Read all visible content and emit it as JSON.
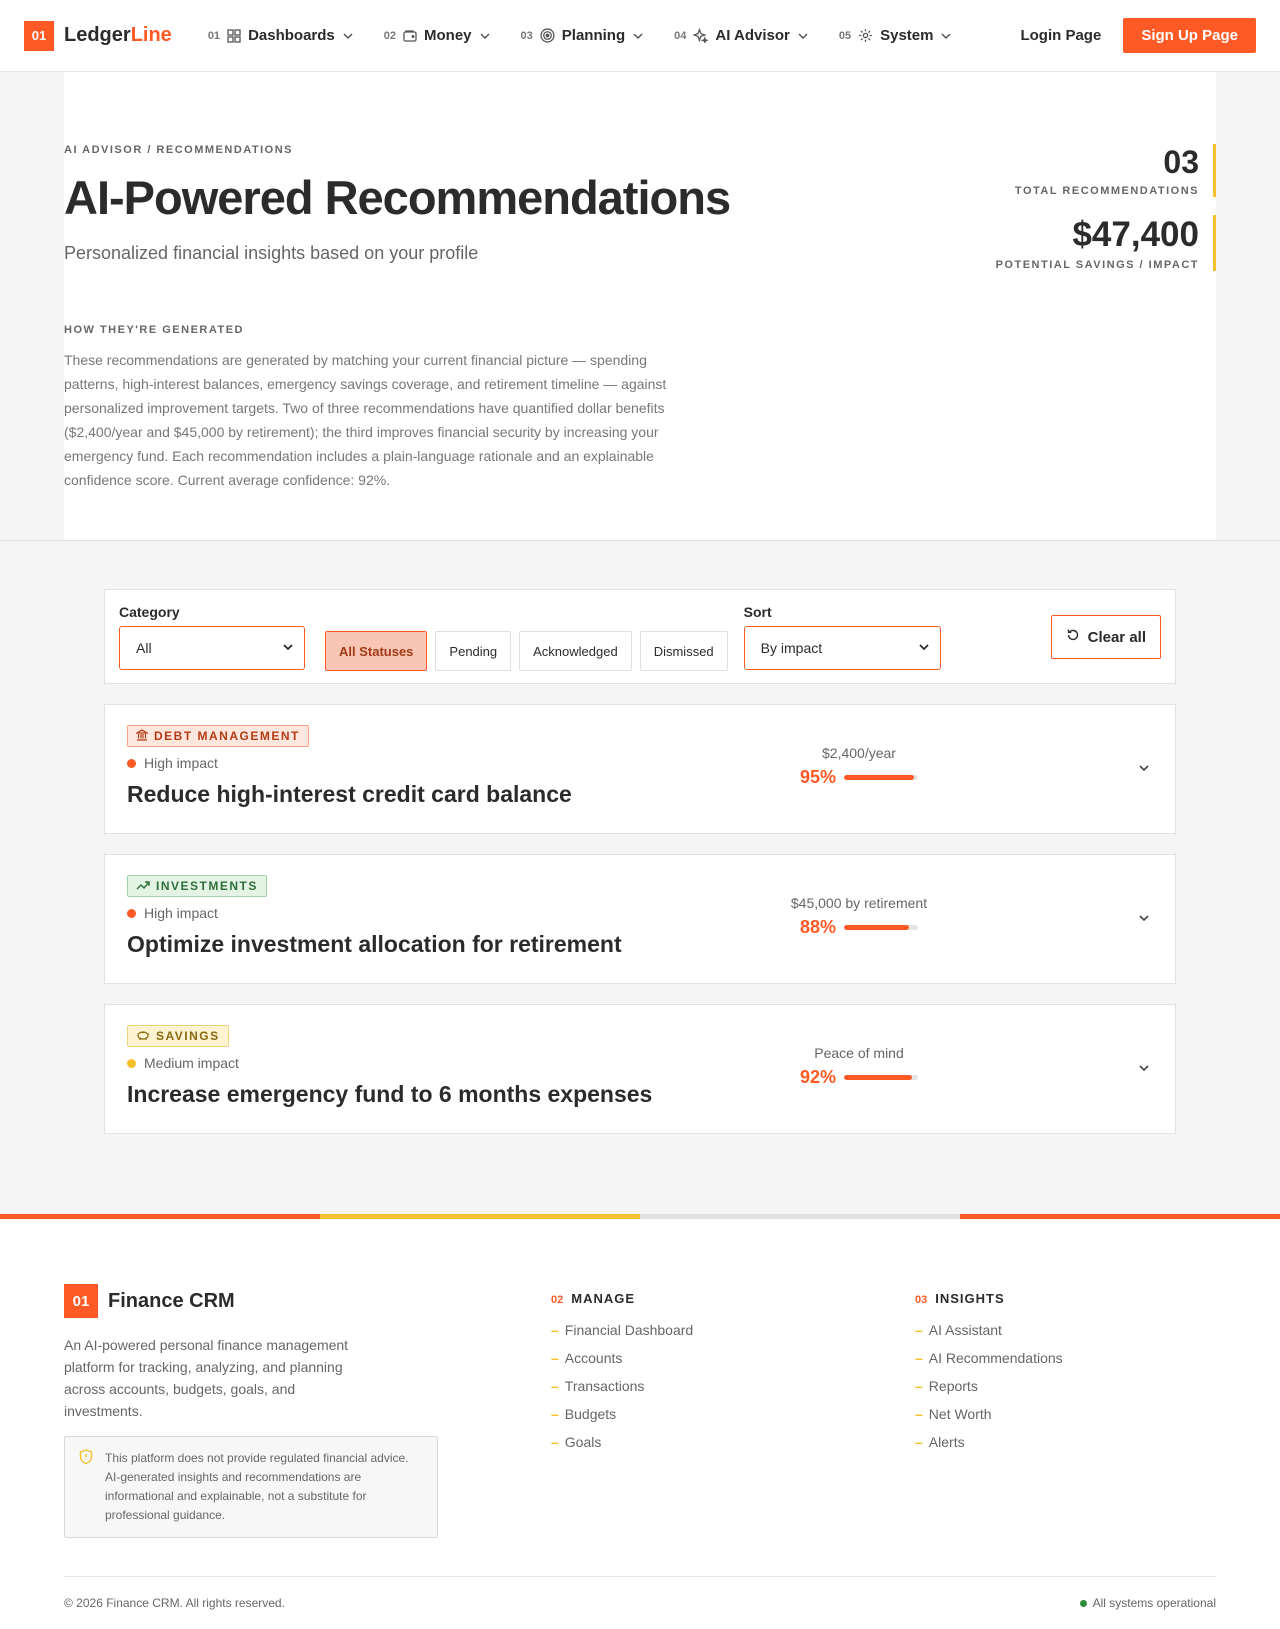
{
  "header": {
    "logo_badge": "01",
    "logo_text": "Ledger",
    "logo_accent": "Line",
    "nav": [
      {
        "num": "01",
        "label": "Dashboards",
        "icon": "grid-icon"
      },
      {
        "num": "02",
        "label": "Money",
        "icon": "wallet-icon"
      },
      {
        "num": "03",
        "label": "Planning",
        "icon": "target-icon"
      },
      {
        "num": "04",
        "label": "AI Advisor",
        "icon": "sparkle-icon"
      },
      {
        "num": "05",
        "label": "System",
        "icon": "gear-icon"
      }
    ],
    "login": "Login Page",
    "signup": "Sign Up Page"
  },
  "hero": {
    "eyebrow": "AI ADVISOR / RECOMMENDATIONS",
    "title": "AI-Powered Recommendations",
    "subtitle": "Personalized financial insights based on your profile",
    "how_title": "HOW THEY'RE GENERATED",
    "how_text": "These recommendations are generated by matching your current financial picture — spending patterns, high-interest balances, emergency savings coverage, and retirement timeline — against personalized improvement targets. Two of three recommendations have quantified dollar benefits ($2,400/year and $45,000 by retirement); the third improves financial security by increasing your emergency fund. Each recommendation includes a plain-language rationale and an explainable confidence score. Current average confidence: 92%.",
    "stats": [
      {
        "value": "03",
        "label": "TOTAL RECOMMENDATIONS"
      },
      {
        "value": "$47,400",
        "label": "POTENTIAL SAVINGS / IMPACT"
      }
    ]
  },
  "filters": {
    "category_label": "Category",
    "category_value": "All",
    "statuses": [
      "All Statuses",
      "Pending",
      "Acknowledged",
      "Dismissed"
    ],
    "active_status": "All Statuses",
    "sort_label": "Sort",
    "sort_value": "By impact",
    "clear": "Clear all"
  },
  "recommendations": [
    {
      "tag": "DEBT MANAGEMENT",
      "tag_icon": "bank-icon",
      "impact": "High impact",
      "title": "Reduce high-interest credit card balance",
      "benefit": "$2,400/year",
      "confidence": "95%",
      "confidence_value": 0.95
    },
    {
      "tag": "INVESTMENTS",
      "tag_icon": "trend-up-icon",
      "impact": "High impact",
      "title": "Optimize investment allocation for retirement",
      "benefit": "$45,000 by retirement",
      "confidence": "88%",
      "confidence_value": 0.88
    },
    {
      "tag": "SAVINGS",
      "tag_icon": "piggy-bank-icon",
      "impact": "Medium impact",
      "title": "Increase emergency fund to 6 months expenses",
      "benefit": "Peace of mind",
      "confidence": "92%",
      "confidence_value": 0.92
    }
  ],
  "footer": {
    "badge": "01",
    "brand": "Finance CRM",
    "description": "An AI-powered personal finance management platform for tracking, analyzing, and planning across accounts, budgets, goals, and investments.",
    "disclaimer": "This platform does not provide regulated financial advice. AI-generated insights and recommendations are informational and explainable, not a substitute for professional guidance.",
    "manage": {
      "num": "02",
      "title": "MANAGE",
      "links": [
        "Financial Dashboard",
        "Accounts",
        "Transactions",
        "Budgets",
        "Goals"
      ]
    },
    "insights": {
      "num": "03",
      "title": "INSIGHTS",
      "links": [
        "AI Assistant",
        "AI Recommendations",
        "Reports",
        "Net Worth",
        "Alerts"
      ]
    },
    "copyright": "© 2026 Finance CRM. All rights reserved.",
    "status": "All systems operational"
  },
  "colors": {
    "accent": "#ff5a26",
    "highlight": "#f5c02b",
    "success": "#2e8b3a"
  }
}
